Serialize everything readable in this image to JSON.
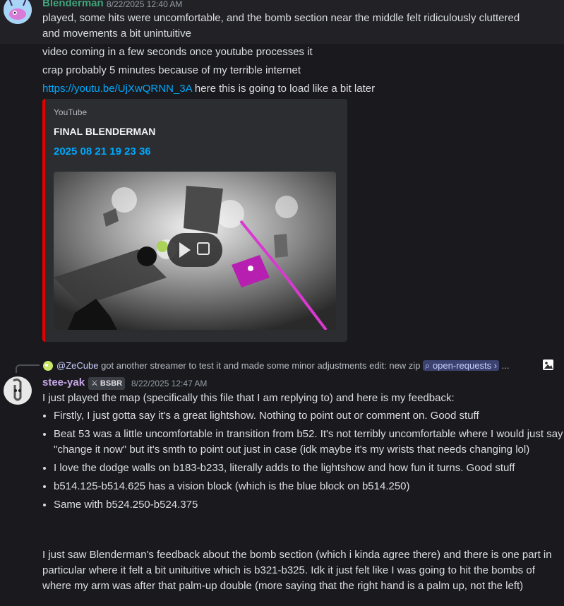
{
  "msg1": {
    "username": "Blenderman",
    "timestamp": "8/22/2025 12:40 AM",
    "line1": "played, some hits were uncomfortable, and the bomb section near the middle felt ridiculously cluttered",
    "line2": "and movements a bit unintuitive",
    "line3": "video coming in a few seconds once youtube processes it",
    "line4": "crap probably 5 minutes because of my terrible internet",
    "link_text": "https://youtu.be/UjXwQRNN_3A",
    "link_suffix": " here this is going to load like a bit later"
  },
  "embed": {
    "provider": "YouTube",
    "author": "FINAL BLENDERMAN",
    "title": "2025 08 21 19 23 36",
    "accent_color": "#e40000"
  },
  "reply": {
    "mention": "@ZeCube",
    "text": "got another streamer to test it and made some minor adjustments  edit: new zip",
    "channel": "open-requests",
    "chevron": "›",
    "ellipsis": "..."
  },
  "msg2": {
    "username": "stee-yak",
    "badge": "BSBR",
    "timestamp": "8/22/2025 12:47 AM",
    "intro": "I just played the map (specifically this file that I am replying to) and here is my feedback:",
    "bullets": [
      "Firstly, I just gotta say it's a great lightshow. Nothing to point out or  comment on. Good stuff",
      "Beat 53 was a little uncomfortable in transition from b52. It's not terribly uncomfortable where I would just say \"change it now\" but it's smth to point out just in case (idk maybe it's my wrists that needs changing lol)",
      "I love the dodge walls on b183-b233, literally adds to the lightshow and how fun it turns. Good stuff",
      "b514.125-b514.625 has a vision block (which is the blue block on b514.250)",
      "Same with b524.250-b524.375"
    ],
    "para": "I just saw Blenderman's feedback about the bomb section (which i kinda agree there) and there is one part in particular where it felt a bit unituitive which is b321-b325. Idk it just felt like I was going to hit the bombs of where my arm was after that palm-up double (more saying that the right hand is a palm up, not the left)"
  },
  "icons": {
    "image_icon": "image-icon",
    "play_icon": "play-icon",
    "share_icon": "share-icon",
    "channel_icon": "forum-channel-icon"
  }
}
